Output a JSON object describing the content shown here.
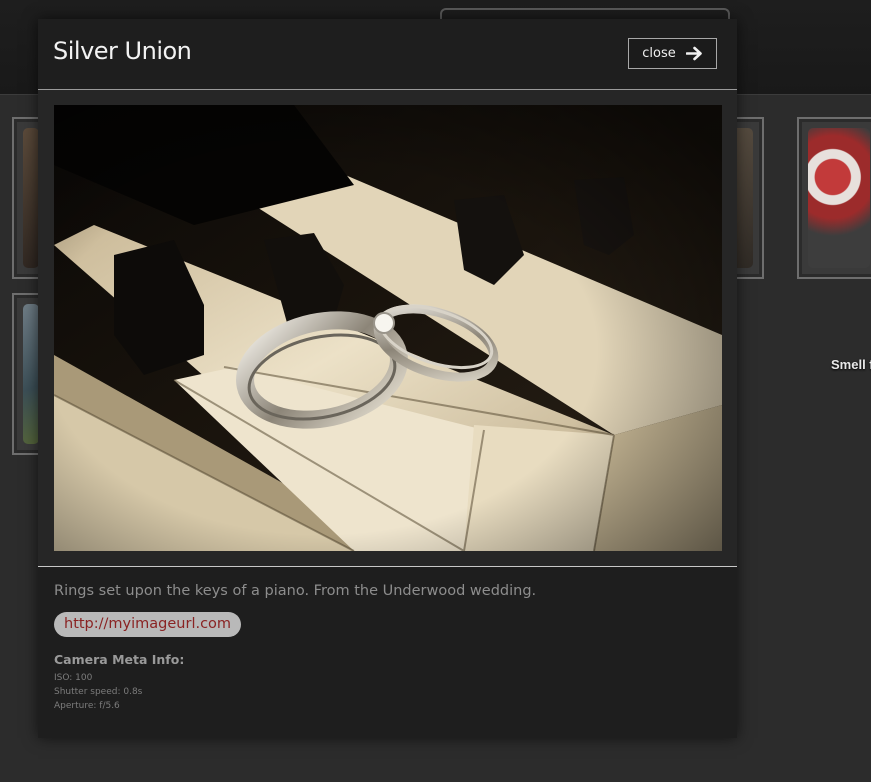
{
  "modal": {
    "title": "Silver Union",
    "close_label": "close",
    "close_icon": "arrow-right-icon",
    "caption": "Rings set upon the keys of a piano. From the Underwood wedding.",
    "url": "http://myimageurl.com",
    "camera_meta": {
      "heading": "Camera Meta Info:",
      "iso": "ISO: 100",
      "shutter": "Shutter speed: 0.8s",
      "aperture": "Aperture: f/5.6"
    }
  },
  "gallery": {
    "thumb_label_right": "Smell f"
  },
  "colors": {
    "link": "#8a2323",
    "modal_bg": "#1e1e1e",
    "page_bg": "#2c2c2c"
  }
}
